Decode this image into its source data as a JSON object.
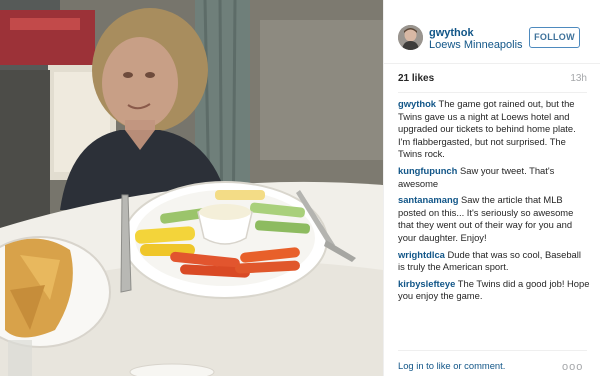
{
  "post": {
    "photo": {
      "alt_icon": "photo",
      "subject": "person at a table with a vegetable platter and chips"
    },
    "header": {
      "username": "gwythok",
      "location": "Loews Minneapolis",
      "follow_label": "FOLLOW"
    },
    "meta": {
      "likes": "21 likes",
      "timestamp": "13h"
    },
    "comments": [
      {
        "user": "gwythok",
        "text": "The game got rained out, but the Twins gave us a night at Loews hotel and upgraded our tickets to behind home plate. I'm flabbergasted, but not surprised. The Twins rock."
      },
      {
        "user": "kungfupunch",
        "text": "Saw your tweet. That's awesome"
      },
      {
        "user": "santanamang",
        "text": "Saw the article that MLB posted on this... It's seriously so awesome that they went out of their way for you and your daughter. Enjoy!"
      },
      {
        "user": "wrightdlca",
        "text": "Dude that was so cool, Baseball is truly the American sport."
      },
      {
        "user": "kirbyslefteye",
        "text": "The Twins did a good job! Hope you enjoy the game."
      }
    ],
    "footer": {
      "login_text": "Log in to like or comment.",
      "more_icon": "ellipsis-icon",
      "more_glyph": "ooo"
    }
  },
  "colors": {
    "link": "#125688",
    "follow_border": "#4e8abe",
    "follow_text": "#3f729b",
    "muted": "#a5a7aa",
    "divider": "#efefef"
  }
}
